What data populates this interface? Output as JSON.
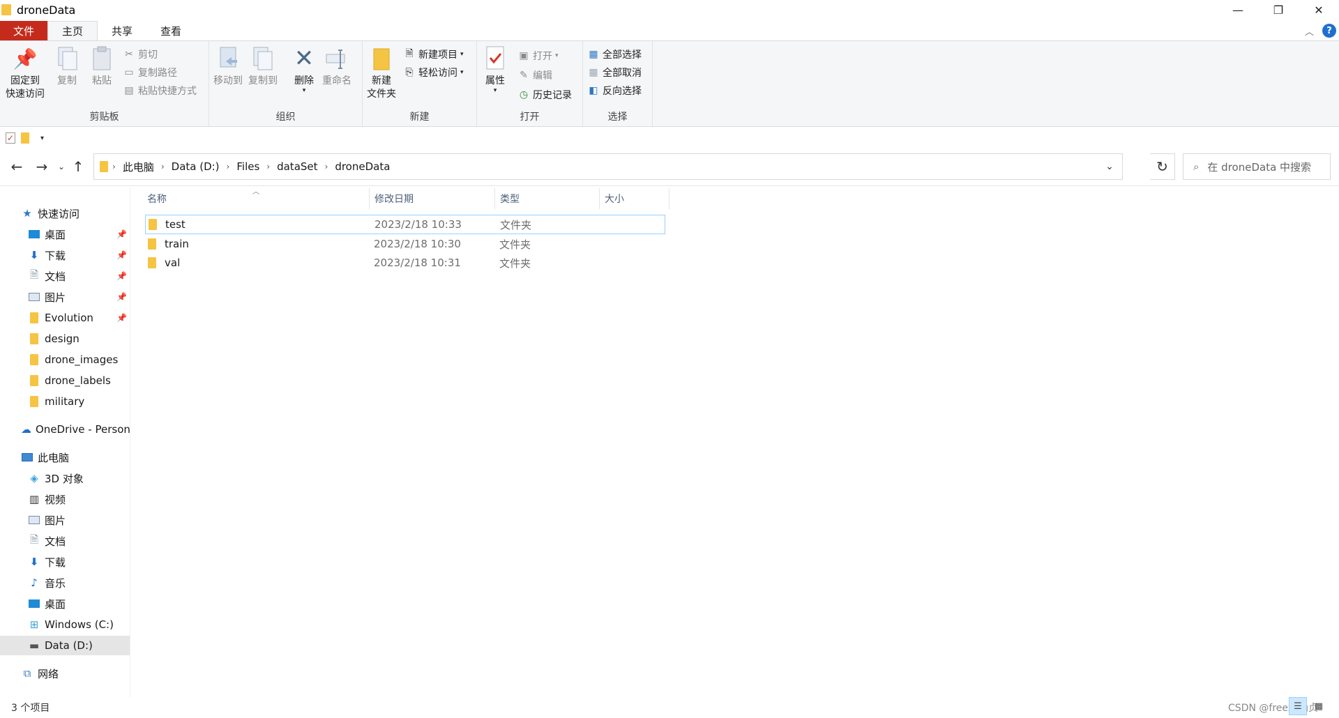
{
  "window": {
    "title": "droneData",
    "controls": {
      "minimize": "—",
      "maximize": "❐",
      "close": "✕"
    }
  },
  "ribbon_tabs": [
    "文件",
    "主页",
    "共享",
    "查看"
  ],
  "ribbon": {
    "clipboard": {
      "label": "剪贴板",
      "pin_line1": "固定到",
      "pin_line2": "快速访问",
      "copy": "复制",
      "paste": "粘贴",
      "cut": "剪切",
      "copy_path": "复制路径",
      "paste_shortcut": "粘贴快捷方式"
    },
    "organize": {
      "label": "组织",
      "move_to": "移动到",
      "copy_to": "复制到",
      "delete": "删除",
      "rename": "重命名"
    },
    "new": {
      "label": "新建",
      "new_folder_line1": "新建",
      "new_folder_line2": "文件夹",
      "new_item": "新建项目",
      "easy_access": "轻松访问"
    },
    "open": {
      "label": "打开",
      "properties": "属性",
      "open": "打开",
      "edit": "编辑",
      "history": "历史记录"
    },
    "select": {
      "label": "选择",
      "select_all": "全部选择",
      "select_none": "全部取消",
      "invert": "反向选择"
    }
  },
  "address": {
    "crumbs": [
      "此电脑",
      "Data (D:)",
      "Files",
      "dataSet",
      "droneData"
    ]
  },
  "search": {
    "placeholder": "在 droneData 中搜索"
  },
  "sidebar": {
    "quick_access": "快速访问",
    "quick_items": [
      {
        "label": "桌面",
        "pinned": true
      },
      {
        "label": "下载",
        "pinned": true
      },
      {
        "label": "文档",
        "pinned": true
      },
      {
        "label": "图片",
        "pinned": true
      },
      {
        "label": "Evolution",
        "pinned": true
      },
      {
        "label": "design",
        "pinned": false
      },
      {
        "label": "drone_images",
        "pinned": false
      },
      {
        "label": "drone_labels",
        "pinned": false
      },
      {
        "label": "military",
        "pinned": false
      }
    ],
    "onedrive": "OneDrive - Person",
    "this_pc": "此电脑",
    "pc_items": [
      "3D 对象",
      "视频",
      "图片",
      "文档",
      "下载",
      "音乐",
      "桌面",
      "Windows (C:)",
      "Data (D:)"
    ],
    "network": "网络"
  },
  "columns": {
    "name": "名称",
    "date": "修改日期",
    "type": "类型",
    "size": "大小"
  },
  "files": [
    {
      "name": "test",
      "date": "2023/2/18 10:33",
      "type": "文件夹"
    },
    {
      "name": "train",
      "date": "2023/2/18 10:30",
      "type": "文件夹"
    },
    {
      "name": "val",
      "date": "2023/2/18 10:31",
      "type": "文件夹"
    }
  ],
  "status": {
    "count": "3 个项目"
  },
  "watermark": "CSDN @freezing贞"
}
